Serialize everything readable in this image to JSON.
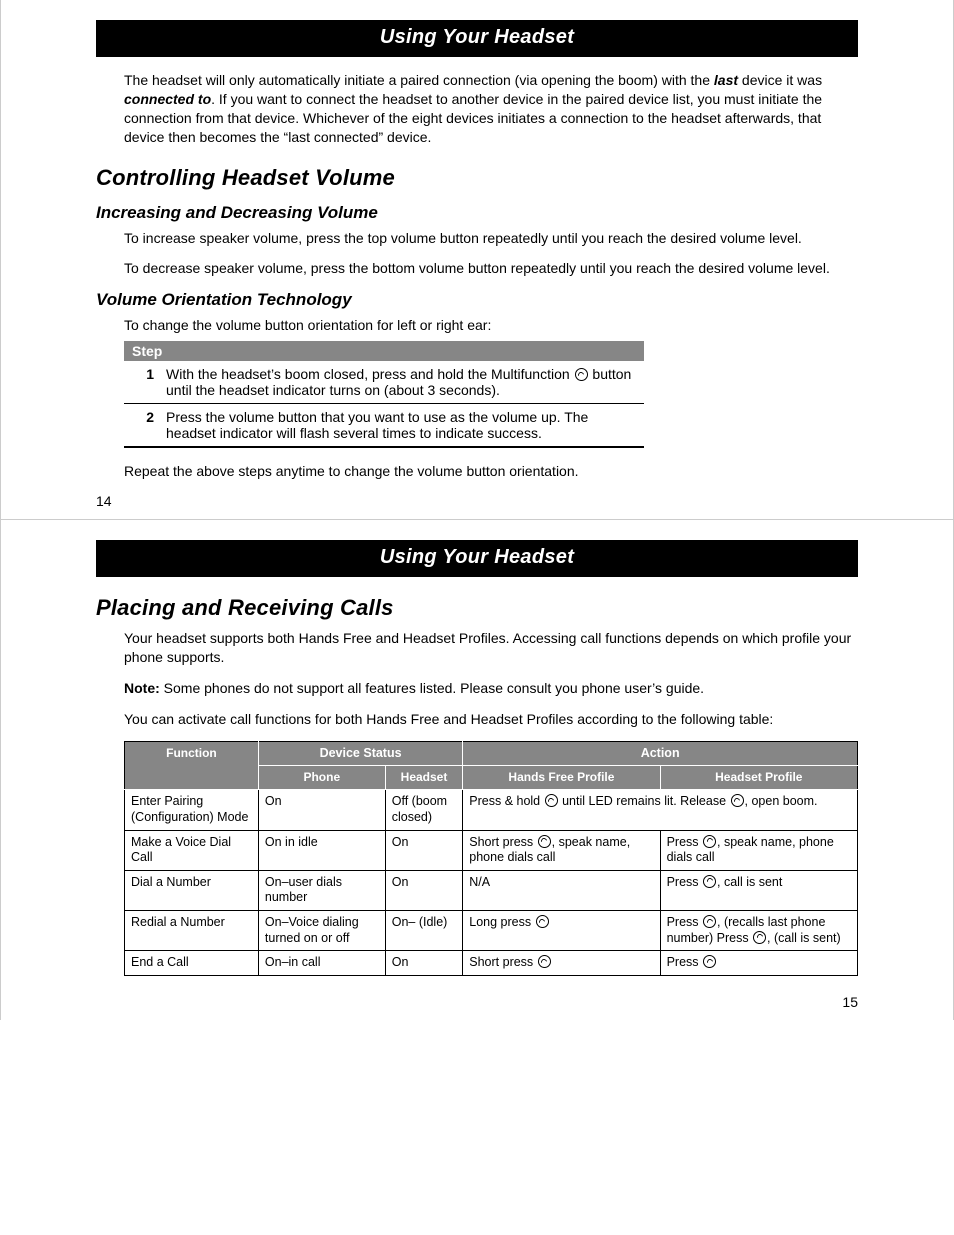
{
  "page14": {
    "banner": "Using Your Headset",
    "intro_pre": "The headset will only automatically initiate a paired connection (via opening the boom) with the ",
    "intro_last": "last",
    "intro_mid1": " device it was ",
    "intro_connected": "connected to",
    "intro_post": ". If you want to connect the headset to another device in the paired device list, you must initiate the connection from that device. Whichever of the eight devices initiates a connection to the headset afterwards, that device then becomes the “last connected” device.",
    "h2_volume": "Controlling Headset Volume",
    "h3_incdec": "Increasing and Decreasing Volume",
    "inc_text": "To increase speaker volume, press the top volume button repeatedly until you reach the desired volume level.",
    "dec_text": "To decrease speaker volume, press the bottom volume button repeatedly until you reach the desired volume level.",
    "h3_orient": "Volume Orientation Technology",
    "orient_intro": "To change the volume button orientation for left or right ear:",
    "step_header": "Step",
    "step1_num": "1",
    "step1_pre": "With the headset’s boom closed, press and hold the Multifunction ",
    "step1_post": " button until the headset indicator turns on (about 3 seconds).",
    "step2_num": "2",
    "step2_text": "Press the volume button that you want to use as the volume up. The headset indicator will flash several times to indicate success.",
    "orient_repeat": "Repeat the above steps anytime to change the volume button orientation.",
    "pagenum": "14"
  },
  "page15": {
    "banner": "Using Your Headset",
    "h2_calls": "Placing and Receiving Calls",
    "calls_intro": "Your headset supports both Hands Free and Headset Profiles. Accessing call functions depends on which profile your phone supports.",
    "note_label": "Note:",
    "note_text": " Some phones do not support all features listed. Please consult you phone user’s guide.",
    "calls_table_intro": "You can activate call functions for both Hands Free and Headset Profiles according to the following table:",
    "th_device_status": "Device Status",
    "th_action": "Action",
    "th_function": "Function",
    "th_phone": "Phone",
    "th_headset": "Headset",
    "th_hfp": "Hands Free Profile",
    "th_hp": "Headset Profile",
    "rows": [
      {
        "func": "Enter Pairing (Configuration) Mode",
        "phone": "On",
        "headset": "Off (boom closed)",
        "hf_pre": "Press & hold ",
        "hf_mid": " until LED remains lit. Release ",
        "hf_post": ", open boom.",
        "merged": true
      },
      {
        "func": "Make a Voice Dial Call",
        "phone": "On in idle",
        "headset": "On",
        "hf_pre": "Short press ",
        "hf_post": ", speak name, phone dials call",
        "hp_pre": "Press ",
        "hp_post": ", speak name, phone dials call"
      },
      {
        "func": "Dial a Number",
        "phone": "On–user dials number",
        "headset": "On",
        "hf_text": "N/A",
        "hp_pre": "Press ",
        "hp_post": ", call is sent"
      },
      {
        "func": "Redial a Number",
        "phone": "On–Voice dialing turned on or off",
        "headset": "On– (Idle)",
        "hf_pre": "Long press ",
        "hf_post": "",
        "hp_pre": "Press ",
        "hp_mid": ", (recalls last phone number) Press ",
        "hp_post": ", (call is sent)"
      },
      {
        "func": "End a Call",
        "phone": "On–in call",
        "headset": "On",
        "hf_pre": "Short press ",
        "hf_post": "",
        "hp_pre": "Press ",
        "hp_post": ""
      }
    ],
    "pagenum": "15"
  }
}
